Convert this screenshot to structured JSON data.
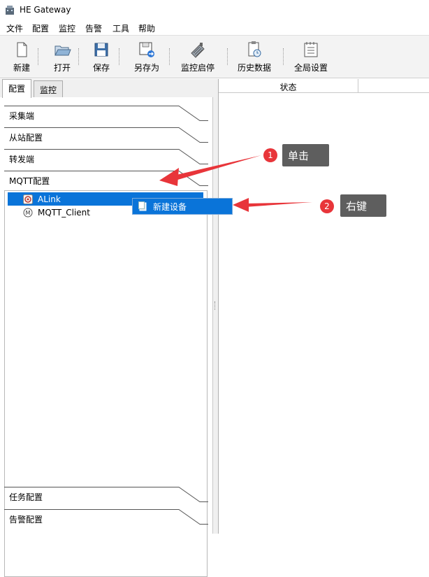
{
  "window": {
    "title": "HE Gateway"
  },
  "menu": [
    {
      "label": "文件"
    },
    {
      "label": "配置"
    },
    {
      "label": "监控"
    },
    {
      "label": "告警"
    },
    {
      "label": "工具"
    },
    {
      "label": "帮助"
    }
  ],
  "toolbar": [
    {
      "label": "新建",
      "icon": "new-file-icon"
    },
    {
      "label": "打开",
      "icon": "open-folder-icon"
    },
    {
      "label": "保存",
      "icon": "save-icon"
    },
    {
      "label": "另存为",
      "icon": "save-as-icon"
    },
    {
      "label": "监控启停",
      "icon": "monitor-toggle-icon"
    },
    {
      "label": "历史数据",
      "icon": "history-data-icon"
    },
    {
      "label": "全局设置",
      "icon": "global-settings-icon"
    }
  ],
  "tabs": [
    {
      "label": "配置",
      "active": true
    },
    {
      "label": "监控",
      "active": false
    }
  ],
  "sections_top": [
    {
      "label": "采集端"
    },
    {
      "label": "从站配置"
    },
    {
      "label": "转发端"
    },
    {
      "label": "MQTT配置"
    }
  ],
  "tree": [
    {
      "label": "ALink",
      "selected": true,
      "icon": "alink-icon"
    },
    {
      "label": "MQTT_Client",
      "selected": false,
      "icon": "mqtt-icon"
    }
  ],
  "context_menu": {
    "item": "新建设备",
    "icon": "new-device-icon"
  },
  "sections_bottom": [
    {
      "label": "任务配置"
    },
    {
      "label": "告警配置"
    }
  ],
  "right_panel": {
    "column": "状态"
  },
  "annotations": [
    {
      "number": "1",
      "text": "单击"
    },
    {
      "number": "2",
      "text": "右键"
    }
  ],
  "colors": {
    "selection": "#0a74d9",
    "annotation_badge": "#e8353a",
    "annotation_note": "#5e5e5e"
  }
}
